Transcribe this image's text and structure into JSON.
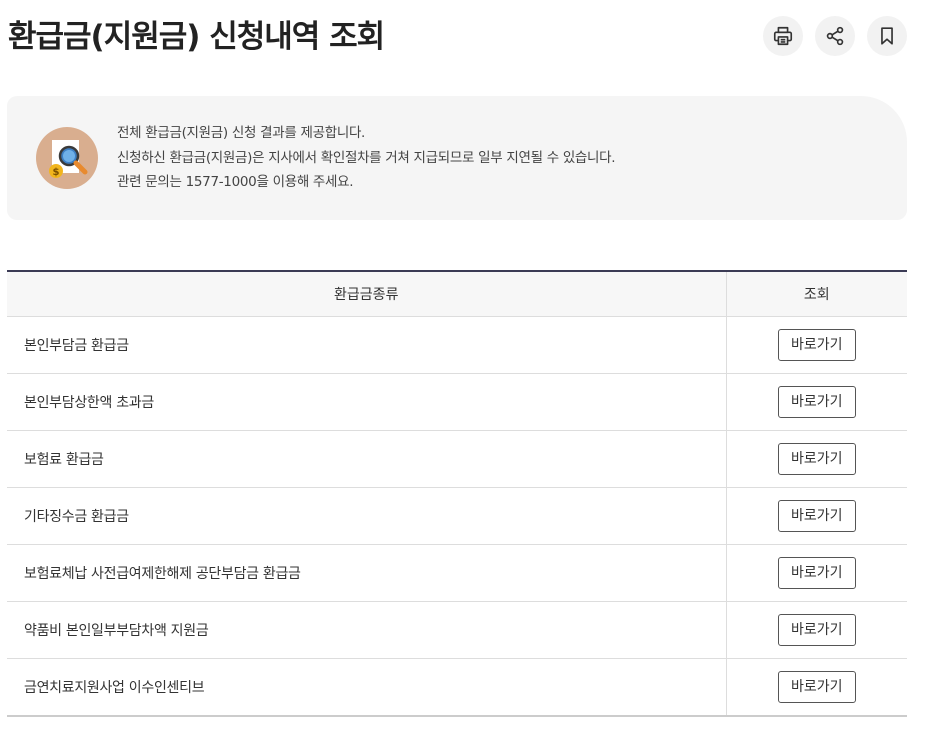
{
  "header": {
    "title": "환급금(지원금) 신청내역 조회",
    "tools": [
      {
        "name": "print-icon"
      },
      {
        "name": "share-icon"
      },
      {
        "name": "bookmark-icon"
      }
    ]
  },
  "info": {
    "icon": "magnifier-money-icon",
    "lines": [
      "전체 환급금(지원금) 신청 결과를 제공합니다.",
      "신청하신 환급금(지원금)은 지사에서 확인절차를 거쳐 지급되므로 일부 지연될 수 있습니다.",
      "관련 문의는 1577-1000을 이용해 주세요."
    ]
  },
  "table": {
    "headers": [
      "환급금종류",
      "조회"
    ],
    "button_label": "바로가기",
    "rows": [
      "본인부담금 환급금",
      "본인부담상한액 초과금",
      "보험료 환급금",
      "기타징수금 환급금",
      "보험료체납 사전급여제한해제 공단부담금 환급금",
      "약품비 본인일부부담차액 지원금",
      "금연치료지원사업 이수인센티브"
    ]
  },
  "colors": {
    "table_top_border": "#3b3b55",
    "info_bg": "#f5f5f5",
    "icon_circle": "#d9ae8f"
  }
}
